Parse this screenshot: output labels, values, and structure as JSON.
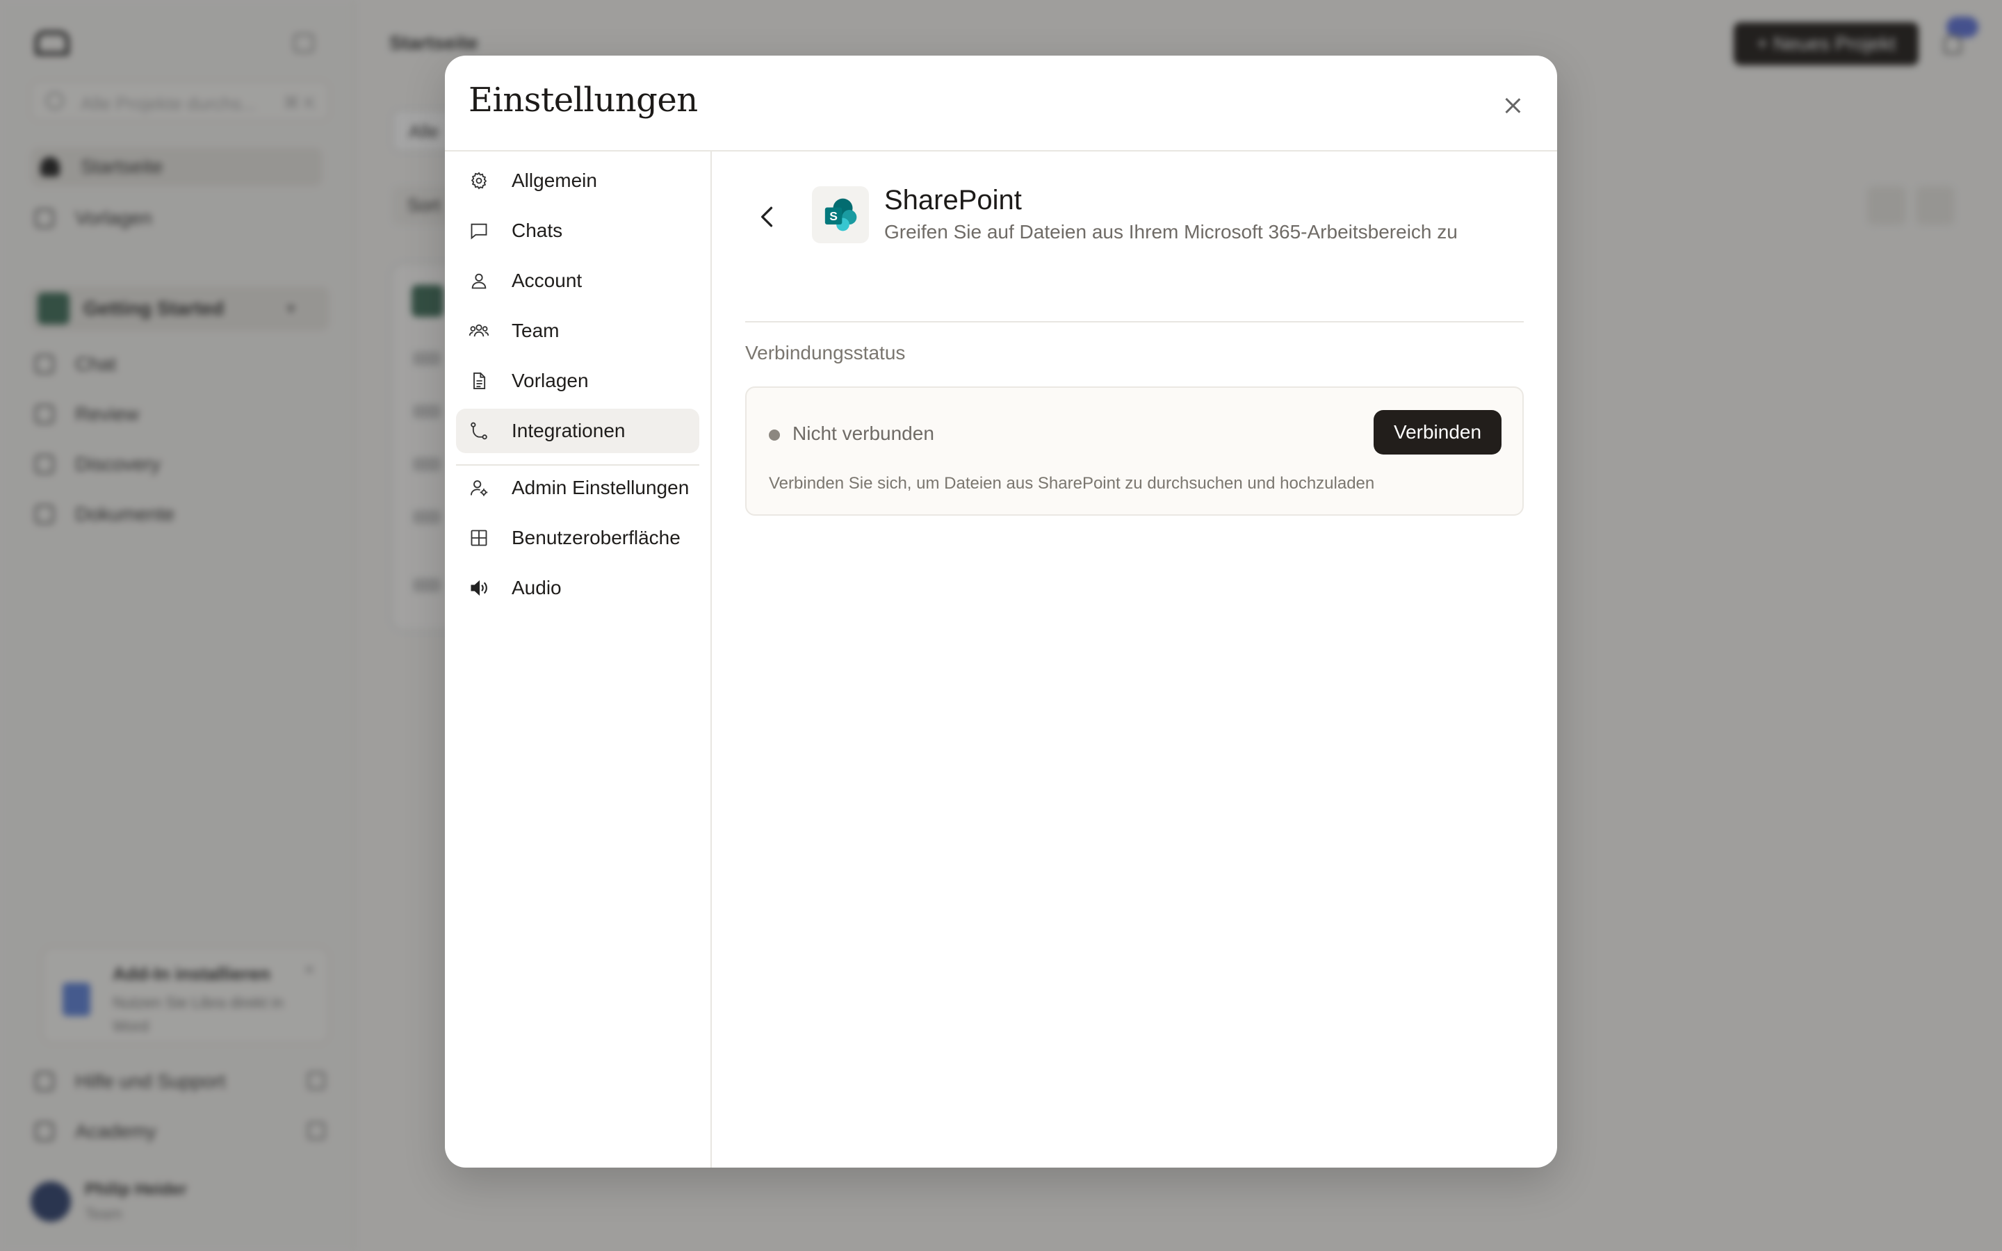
{
  "background": {
    "search_placeholder": "Alle Projekte durchs...",
    "search_shortcut": "⌘ K",
    "nav": [
      "Startseite",
      "Vorlagen"
    ],
    "project_group": "Getting Started",
    "project_items": [
      "Chat",
      "Review",
      "Discovery",
      "Dokumente"
    ],
    "promo_title": "Add-In installieren",
    "promo_text": "Nutzen Sie Libra direkt in Word",
    "footer_links": [
      "Hilfe und Support",
      "Academy"
    ],
    "user_name": "Philip Heider",
    "user_role": "Team",
    "page_title": "Startseite",
    "new_project": "+ Neues Projekt",
    "filter_label": "Alle",
    "sort_label": "Sort"
  },
  "modal": {
    "title": "Einstellungen",
    "nav": [
      {
        "label": "Allgemein",
        "icon": "gear-icon"
      },
      {
        "label": "Chats",
        "icon": "chat-bubble-icon"
      },
      {
        "label": "Account",
        "icon": "user-icon"
      },
      {
        "label": "Team",
        "icon": "team-icon"
      },
      {
        "label": "Vorlagen",
        "icon": "document-icon"
      },
      {
        "label": "Integrationen",
        "icon": "integration-icon",
        "active": true
      },
      {
        "label": "Admin Einstellungen",
        "icon": "admin-user-icon"
      },
      {
        "label": "Benutzeroberfläche",
        "icon": "grid-icon"
      },
      {
        "label": "Audio",
        "icon": "speaker-icon"
      }
    ],
    "integration": {
      "name": "SharePoint",
      "description": "Greifen Sie auf Dateien aus Ihrem Microsoft 365-Arbeitsbereich zu",
      "section_label": "Verbindungsstatus",
      "status": "Nicht verbunden",
      "connect_label": "Verbinden",
      "hint": "Verbinden Sie sich, um Dateien aus SharePoint zu durchsuchen und hochzuladen",
      "logo_letter": "S"
    }
  },
  "colors": {
    "accent_dark": "#221e1b",
    "sharepoint_teal": "#038387",
    "status_gray": "#8c8780"
  }
}
